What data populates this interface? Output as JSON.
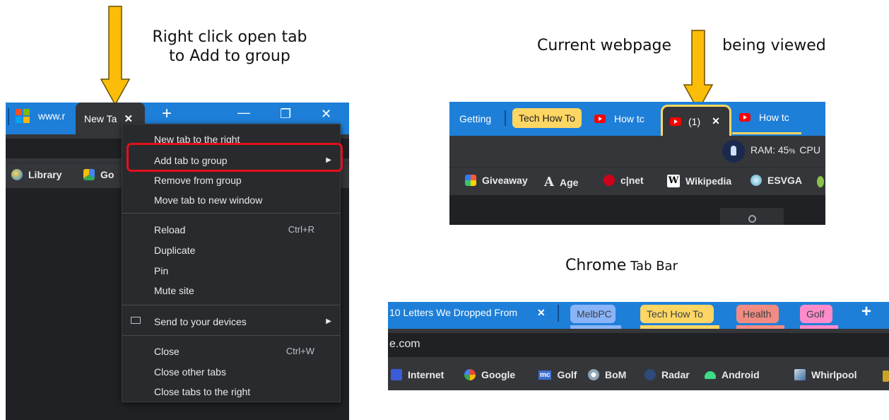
{
  "captions": {
    "left": "Right click open tab\nto Add to group",
    "current_before": "Current webpage",
    "current_after": "being viewed",
    "chrome_tab_bar_big": "Chrome",
    "chrome_tab_bar_small": " Tab Bar"
  },
  "panel1": {
    "tabs": [
      {
        "label": "www.r"
      },
      {
        "label": "New Ta"
      }
    ],
    "tab_close": "✕",
    "new_tab": "+",
    "window_controls": {
      "minimize": "—",
      "restore": "❐",
      "close": "✕"
    },
    "bookmarks": [
      {
        "label": "Library"
      },
      {
        "label": "Go"
      }
    ],
    "context_menu": {
      "items": [
        {
          "label": "New tab to the right"
        },
        {
          "label": "Add tab to group",
          "submenu": "▶"
        },
        {
          "label": "Remove from group"
        },
        {
          "label": "Move tab to new window"
        },
        {
          "label": "Reload",
          "shortcut": "Ctrl+R"
        },
        {
          "label": "Duplicate"
        },
        {
          "label": "Pin"
        },
        {
          "label": "Mute site"
        },
        {
          "label": "Send to your devices",
          "submenu": "▶"
        },
        {
          "label": "Close",
          "shortcut": "Ctrl+W"
        },
        {
          "label": "Close other tabs"
        },
        {
          "label": "Close tabs to the right"
        }
      ]
    }
  },
  "panel2": {
    "tabs": {
      "getting": "Getting",
      "group_chip": "Tech How To",
      "how1": "How tc",
      "current": "(1)",
      "close": "✕",
      "how2": "How tc"
    },
    "extension": {
      "ram": "RAM: 45",
      "pct": "%",
      "cpu": "CPU"
    },
    "bookmarks": [
      {
        "label": "Giveaway"
      },
      {
        "label": "Age",
        "glyph": "A"
      },
      {
        "label": "c|net"
      },
      {
        "label": "Wikipedia",
        "glyph": "W"
      },
      {
        "label": "ESVGA"
      }
    ]
  },
  "panel3": {
    "first_tab": "10 Letters We Dropped From",
    "close": "✕",
    "groups": [
      {
        "label": "MelbPC",
        "color": "#8ab4f8"
      },
      {
        "label": "Tech How To",
        "color": "#fdd663"
      },
      {
        "label": "Health",
        "color": "#f28b82"
      },
      {
        "label": "Golf",
        "color": "#ff8bcb"
      }
    ],
    "new_tab": "+",
    "address": "e.com",
    "bookmarks": [
      {
        "label": "Internet"
      },
      {
        "label": "Google"
      },
      {
        "label": "Golf",
        "glyph": "mc"
      },
      {
        "label": "BoM"
      },
      {
        "label": "Radar"
      },
      {
        "label": "Android"
      },
      {
        "label": "Whirlpool"
      }
    ]
  },
  "colors": {
    "arrow": "#fbbd08",
    "highlight": "#e3101a",
    "tabstrip": "#1e7fd8",
    "group_yellow": "#fdd663"
  }
}
